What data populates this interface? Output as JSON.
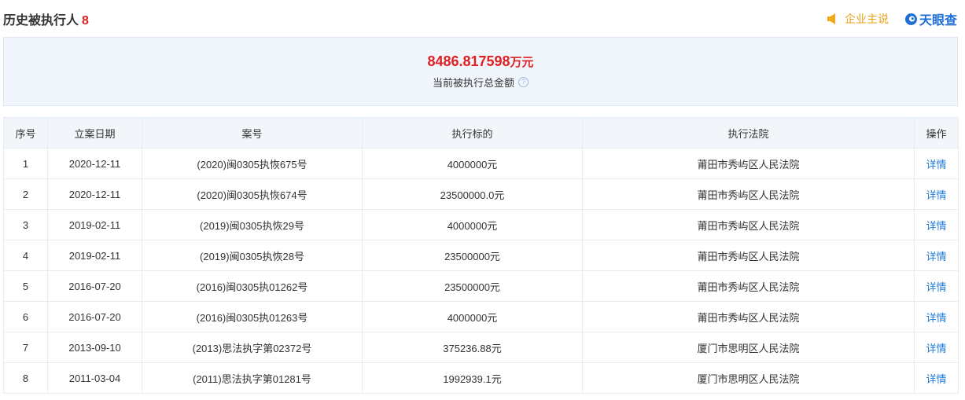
{
  "header": {
    "title": "历史被执行人",
    "count": "8",
    "claim_label": "企业主说",
    "brand_name": "天眼查"
  },
  "summary": {
    "amount": "8486.817598",
    "unit": "万元",
    "label": "当前被执行总金额",
    "help": "?"
  },
  "table": {
    "columns": [
      "序号",
      "立案日期",
      "案号",
      "执行标的",
      "执行法院",
      "操作"
    ],
    "rows": [
      [
        "1",
        "2020-12-11",
        "(2020)闽0305执恢675号",
        "4000000元",
        "莆田市秀屿区人民法院",
        "详情"
      ],
      [
        "2",
        "2020-12-11",
        "(2020)闽0305执恢674号",
        "23500000.0元",
        "莆田市秀屿区人民法院",
        "详情"
      ],
      [
        "3",
        "2019-02-11",
        "(2019)闽0305执恢29号",
        "4000000元",
        "莆田市秀屿区人民法院",
        "详情"
      ],
      [
        "4",
        "2019-02-11",
        "(2019)闽0305执恢28号",
        "23500000元",
        "莆田市秀屿区人民法院",
        "详情"
      ],
      [
        "5",
        "2016-07-20",
        "(2016)闽0305执01262号",
        "23500000元",
        "莆田市秀屿区人民法院",
        "详情"
      ],
      [
        "6",
        "2016-07-20",
        "(2016)闽0305执01263号",
        "4000000元",
        "莆田市秀屿区人民法院",
        "详情"
      ],
      [
        "7",
        "2013-09-10",
        "(2013)思法执字第02372号",
        "375236.88元",
        "厦门市思明区人民法院",
        "详情"
      ],
      [
        "8",
        "2011-03-04",
        "(2011)思法执字第01281号",
        "1992939.1元",
        "厦门市思明区人民法院",
        "详情"
      ]
    ]
  },
  "colors": {
    "accent_red": "#e02020",
    "link_blue": "#1e7ad8",
    "claim_orange": "#e8a21a",
    "summary_bg": "#f0f6fc"
  },
  "icons": {
    "claim": "speaker-icon",
    "brand": "tianyancha-logo-icon",
    "help": "help-icon"
  }
}
